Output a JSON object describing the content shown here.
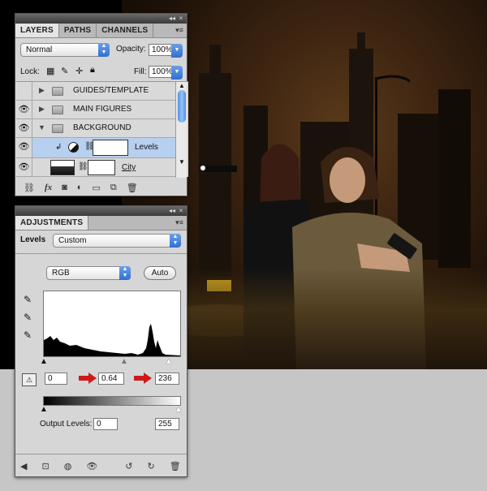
{
  "layers_panel": {
    "tabs": [
      "LAYERS",
      "PATHS",
      "CHANNELS"
    ],
    "blend_mode": "Normal",
    "opacity_label": "Opacity:",
    "opacity_value": "100%",
    "lock_label": "Lock:",
    "fill_label": "Fill:",
    "fill_value": "100%",
    "layers": [
      {
        "name": "GUIDES/TEMPLATE",
        "type": "folder",
        "visible": false,
        "expanded": false
      },
      {
        "name": "MAIN FIGURES",
        "type": "folder",
        "visible": true,
        "expanded": false
      },
      {
        "name": "BACKGROUND",
        "type": "folder",
        "visible": true,
        "expanded": true
      },
      {
        "name": "Levels",
        "type": "adjustment",
        "visible": true,
        "selected": true
      },
      {
        "name": "City",
        "type": "image",
        "visible": true
      }
    ],
    "bottom_icons": [
      "link-icon",
      "fx-icon",
      "mask-icon",
      "adjustment-icon",
      "group-icon",
      "new-layer-icon",
      "trash-icon"
    ],
    "fx_label": "fx"
  },
  "adjustments_panel": {
    "tab": "ADJUSTMENTS",
    "type_label": "Levels",
    "preset": "Custom",
    "channel": "RGB",
    "auto_label": "Auto",
    "input_black": "0",
    "input_gamma": "0.64",
    "input_white": "236",
    "output_label": "Output Levels:",
    "output_black": "0",
    "output_white": "255",
    "accent_color": "#cc1a1a"
  }
}
